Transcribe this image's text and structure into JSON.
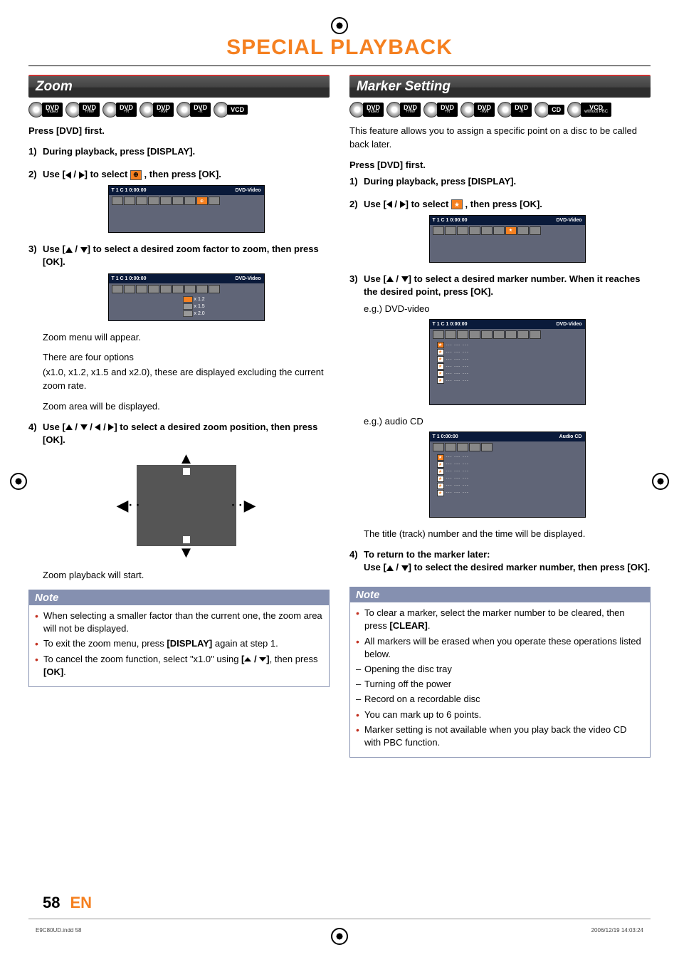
{
  "page_title": "SPECIAL PLAYBACK",
  "footer": {
    "page_num": "58",
    "lang": "EN",
    "file": "E9C80UD.indd   58",
    "date": "2006/12/19   14:03:24"
  },
  "note_label": "Note",
  "left": {
    "section": "Zoom",
    "discs": [
      {
        "t": "DVD",
        "s": "Video"
      },
      {
        "t": "DVD",
        "s": "+RW"
      },
      {
        "t": "DVD",
        "s": "+R"
      },
      {
        "t": "DVD",
        "s": "-RW"
      },
      {
        "t": "DVD",
        "s": "-R"
      },
      {
        "t": "VCD",
        "s": ""
      }
    ],
    "press_first": "Press [DVD] first.",
    "s1": "During playback, press [DISPLAY].",
    "s2_pre": "Use [",
    "s2_mid": "] to select ",
    "s2_post": " , then press [OK].",
    "osd1": {
      "tc": "T  1  C 1    0:00:00",
      "type": "DVD-Video"
    },
    "s3_a": "Use [",
    "s3_b": "] to select a desired zoom factor to zoom, then press [OK].",
    "osd2": {
      "tc": "T  1  C 1    0:00:00",
      "type": "DVD-Video",
      "zoom": [
        "x 1.2",
        "x 1.5",
        "x 2.0"
      ]
    },
    "zoom_menu": "Zoom menu will appear.",
    "zoom_opts": "There are four options",
    "zoom_list": "(x1.0, x1.2, x1.5 and x2.0), these are displayed excluding the current zoom rate.",
    "zoom_area": "Zoom area will be displayed.",
    "s4_a": "Use [",
    "s4_b": "] to select a desired zoom position, then press [OK].",
    "zoom_start": "Zoom playback will start.",
    "note1": "When selecting a smaller factor than the current one, the zoom area will not be displayed.",
    "note2_a": "To exit the zoom menu, press ",
    "note2_b": "[DISPLAY]",
    "note2_c": " again at step 1.",
    "note3_a": "To cancel the zoom function, select \"x1.0\" using ",
    "note3_b": "[",
    "note3_c": "]",
    "note3_d": ", then press ",
    "note3_e": "[OK]",
    "note3_f": "."
  },
  "right": {
    "section": "Marker Setting",
    "discs": [
      {
        "t": "DVD",
        "s": "Video"
      },
      {
        "t": "DVD",
        "s": "+RW"
      },
      {
        "t": "DVD",
        "s": "+R"
      },
      {
        "t": "DVD",
        "s": "-RW"
      },
      {
        "t": "DVD",
        "s": "-R"
      },
      {
        "t": "CD",
        "s": ""
      },
      {
        "t": "VCD",
        "s": "without PBC"
      }
    ],
    "intro": "This feature allows you to assign a specific point on a disc to be called back later.",
    "press_first": "Press [DVD] first.",
    "s1": "During playback, press [DISPLAY].",
    "s2_pre": "Use [",
    "s2_mid": "] to select ",
    "s2_post": " , then press [OK].",
    "osd1": {
      "tc": "T  1  C 1    0:00:00",
      "type": "DVD-Video"
    },
    "s3_a": "Use [",
    "s3_b": "] to select a desired marker number. When it reaches the desired point, press [OK].",
    "eg1": "e.g.) DVD-video",
    "osd2": {
      "tc": "T  1  C 1    0:00:00",
      "type": "DVD-Video"
    },
    "eg2": "e.g.) audio CD",
    "osd3": {
      "tc": "T  1    0:00:00",
      "type": "Audio CD"
    },
    "track_note": "The title (track) number and the time will be displayed.",
    "s4_a": "To return to the marker later:",
    "s4_b_pre": "Use [",
    "s4_b_post": "] to select the desired marker number, then press [OK].",
    "note1_a": "To clear a marker, select the marker number to be cleared, then press ",
    "note1_b": "[CLEAR]",
    "note1_c": ".",
    "note2": "All markers will be erased when you operate these operations listed below.",
    "note2a": "Opening the disc tray",
    "note2b": "Turning off the power",
    "note2c": "Record on a recordable disc",
    "note3": "You can mark up to 6 points.",
    "note4": "Marker setting is not available when you play back the video CD with PBC function."
  }
}
